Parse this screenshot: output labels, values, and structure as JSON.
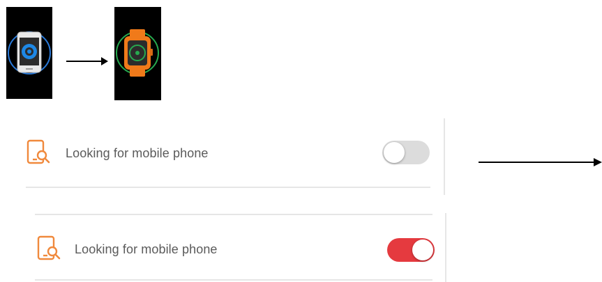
{
  "illustration": {
    "source_icon": "phone-find-icon",
    "target_icon": "watch-find-icon",
    "source_ring_color": "#2a7ad9",
    "target_ring_color": "#27a94f",
    "watch_color": "#f07a1a"
  },
  "rows": [
    {
      "icon": "phone-search-icon",
      "label": "Looking for mobile phone",
      "toggle_on": false,
      "toggle_color": "#dcdcdc"
    },
    {
      "icon": "phone-search-icon",
      "label": "Looking for mobile phone",
      "toggle_on": true,
      "toggle_color": "#e53a3f"
    }
  ],
  "colors": {
    "accent_icon": "#f0893c",
    "divider": "#e6e6e6",
    "label_text": "#5a5a5a",
    "arrow": "#000000"
  }
}
